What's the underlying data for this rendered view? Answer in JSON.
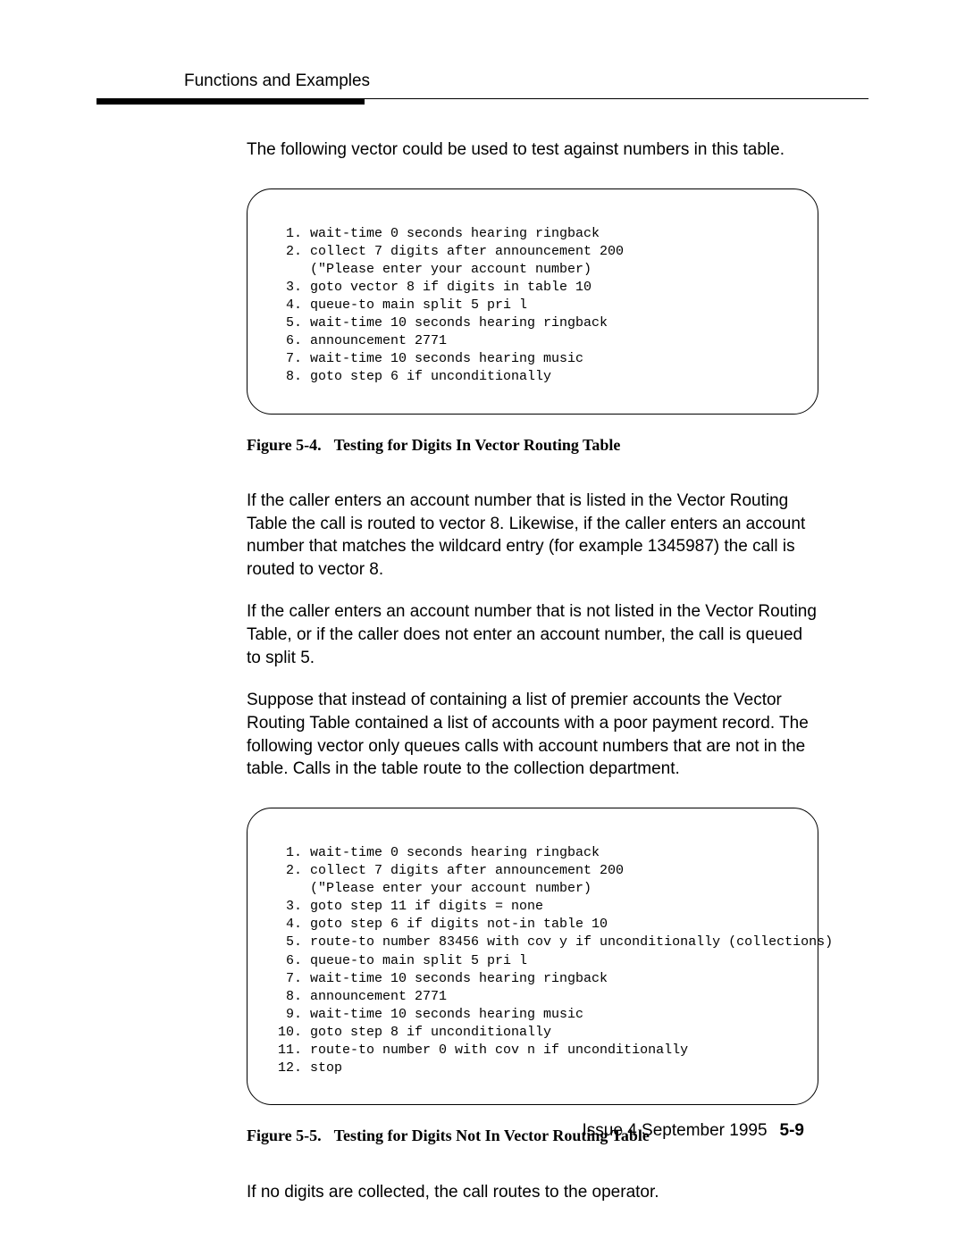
{
  "header": {
    "title": "Functions and Examples"
  },
  "body": {
    "p1": "The following vector could be used to test against numbers in this table.",
    "code1": {
      "l1": " 1. wait-time 0 seconds hearing ringback",
      "l2": " 2. collect 7 digits after announcement 200",
      "l2b": "    (\"Please enter your account number)",
      "l3": " 3. goto vector 8 if digits in table 10",
      "l4": " 4. queue-to main split 5 pri l",
      "l5": " 5. wait-time 10 seconds hearing ringback",
      "l6": " 6. announcement 2771",
      "l7": " 7. wait-time 10 seconds hearing music",
      "l8": " 8. goto step 6 if unconditionally"
    },
    "caption1_label": "Figure 5-4.",
    "caption1_text": "Testing for Digits In Vector Routing Table",
    "p2": "If the caller enters an account number that is listed in the Vector Routing Table the call is routed to vector 8. Likewise, if the caller enters an account number that matches the wildcard entry (for example 1345987) the call is routed to vector 8.",
    "p3": "If the caller enters an account number that is not listed in the Vector Routing Table, or if the caller does not enter an account number, the call is queued to split 5.",
    "p4": "Suppose that instead of containing a list of premier accounts the Vector Routing Table contained a list of accounts with a poor payment record. The following vector only queues calls with account numbers that are not in the table. Calls in the table route to the collection department.",
    "code2": {
      "l1": " 1. wait-time 0 seconds hearing ringback",
      "l2": " 2. collect 7 digits after announcement 200",
      "l2b": "    (\"Please enter your account number)",
      "l3": " 3. goto step 11 if digits = none",
      "l4": " 4. goto step 6 if digits not-in table 10",
      "l5": " 5. route-to number 83456 with cov y if unconditionally (collections)",
      "l6": " 6. queue-to main split 5 pri l",
      "l7": " 7. wait-time 10 seconds hearing ringback",
      "l8": " 8. announcement 2771",
      "l9": " 9. wait-time 10 seconds hearing music",
      "l10": "10. goto step 8 if unconditionally",
      "l11": "11. route-to number 0 with cov n if unconditionally",
      "l12": "12. stop"
    },
    "caption2_label": "Figure 5-5.",
    "caption2_text": "Testing for Digits Not In Vector Routing Table",
    "p5": "If no digits are collected, the call routes to the operator."
  },
  "footer": {
    "issue": "Issue 4 September 1995",
    "page": "5-9"
  }
}
